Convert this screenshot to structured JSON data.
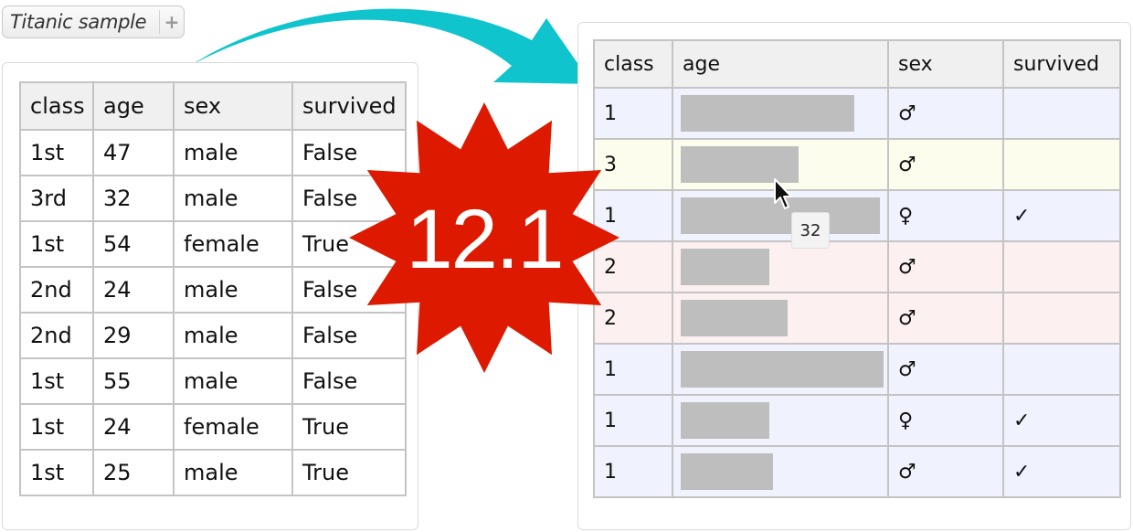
{
  "tag": {
    "label": "Titanic sample",
    "add_icon": "plus-icon"
  },
  "left_table": {
    "headers": [
      "class",
      "age",
      "sex",
      "survived"
    ],
    "rows": [
      [
        "1st",
        "47",
        "male",
        "False"
      ],
      [
        "3rd",
        "32",
        "male",
        "False"
      ],
      [
        "1st",
        "54",
        "female",
        "True"
      ],
      [
        "2nd",
        "24",
        "male",
        "False"
      ],
      [
        "2nd",
        "29",
        "male",
        "False"
      ],
      [
        "1st",
        "55",
        "male",
        "False"
      ],
      [
        "1st",
        "24",
        "female",
        "True"
      ],
      [
        "1st",
        "25",
        "male",
        "True"
      ]
    ]
  },
  "right_table": {
    "headers": [
      "class",
      "age",
      "sex",
      "survived"
    ],
    "rows": [
      {
        "class": "1",
        "age": 47,
        "sex": "♂",
        "survived": "",
        "tint": "blue"
      },
      {
        "class": "3",
        "age": 32,
        "sex": "♂",
        "survived": "",
        "tint": "yellow"
      },
      {
        "class": "1",
        "age": 54,
        "sex": "♀",
        "survived": "✓",
        "tint": "blue"
      },
      {
        "class": "2",
        "age": 24,
        "sex": "♂",
        "survived": "",
        "tint": "pink"
      },
      {
        "class": "2",
        "age": 29,
        "sex": "♂",
        "survived": "",
        "tint": "pink"
      },
      {
        "class": "1",
        "age": 55,
        "sex": "♂",
        "survived": "",
        "tint": "blue"
      },
      {
        "class": "1",
        "age": 24,
        "sex": "♀",
        "survived": "✓",
        "tint": "blue"
      },
      {
        "class": "1",
        "age": 25,
        "sex": "♂",
        "survived": "✓",
        "tint": "blue"
      }
    ],
    "age_max": 55
  },
  "badge": {
    "text": "12.1",
    "color": "#dd1a00"
  },
  "tooltip": {
    "text": "32"
  },
  "arrow_color": "#0fc4cc"
}
